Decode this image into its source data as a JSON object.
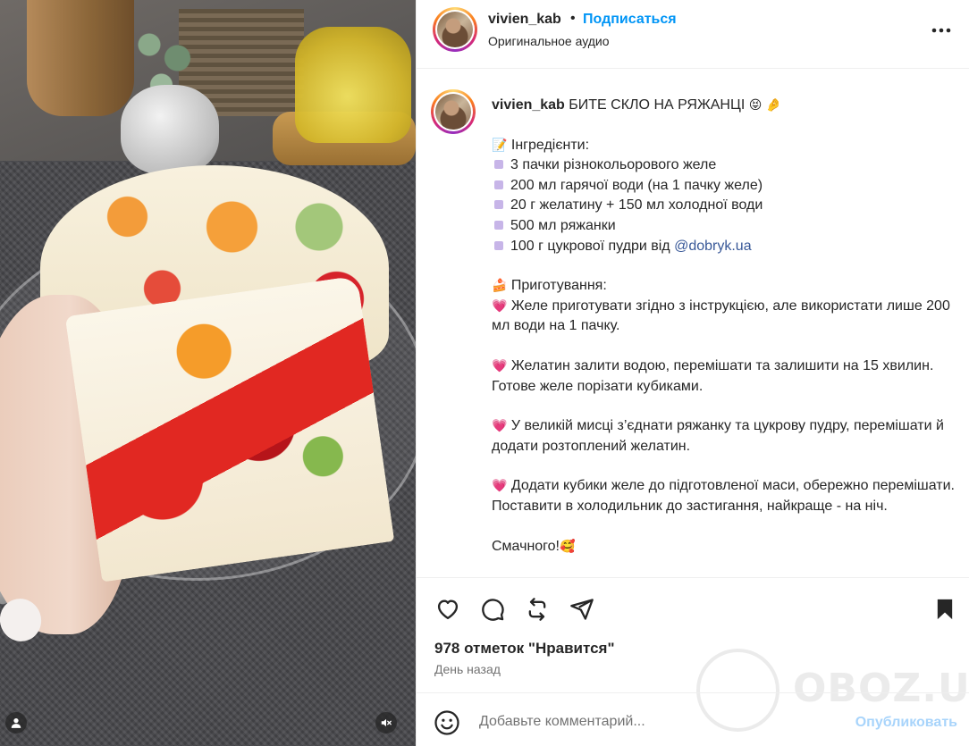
{
  "post": {
    "username": "vivien_kab",
    "separator": "•",
    "follow_label": "Подписаться",
    "audio_label": "Оригинальное аудио"
  },
  "caption": {
    "username": "vivien_kab",
    "title": "БИТЕ СКЛО НА РЯЖАНЦІ",
    "title_emoji": "😝 🤌",
    "ingredients_emoji": "📝",
    "ingredients_title": "Інгредієнти:",
    "ingredients": [
      "3 пачки різнокольорового желе",
      "200 мл гарячої води (на 1 пачку желе)",
      "20 г желатину + 150 мл холодної води",
      "500 мл ряжанки",
      "100 г цукрової пудри від "
    ],
    "mention": "@dobryk.ua",
    "prep_emoji": "🍰",
    "prep_title": "Приготування:",
    "steps": [
      "Желе приготувати згідно з інструкцією, але використати лише 200 мл води на 1 пачку.",
      "Желатин залити водою, перемішати та залишити на 15 хвилин. Готове желе порізати кубиками.",
      "У великій мисці з’єднати ряжанку та цукрову пудру, перемішати й додати розтоплений желатин.",
      "Додати кубики желе до підготовленої маси, обережно перемішати. Поставити в холодильник до застигання, найкраще - на ніч."
    ],
    "heart": "💗",
    "closing": "Смачного!",
    "closing_emoji": "🥰"
  },
  "actions": {
    "like_icon": "heart-icon",
    "comment_icon": "comment-icon",
    "share_icon": "repost-icon",
    "send_icon": "send-icon",
    "save_icon": "bookmark-icon"
  },
  "likes_text": "978 отметок \"Нравится\"",
  "date_text": "День назад",
  "comment": {
    "placeholder": "Добавьте комментарий...",
    "publish_label": "Опубликовать"
  },
  "watermark": "OBOZ.UA",
  "colors": {
    "accent": "#0095f6",
    "publish_disabled": "#a8d4fb",
    "link": "#385898"
  }
}
